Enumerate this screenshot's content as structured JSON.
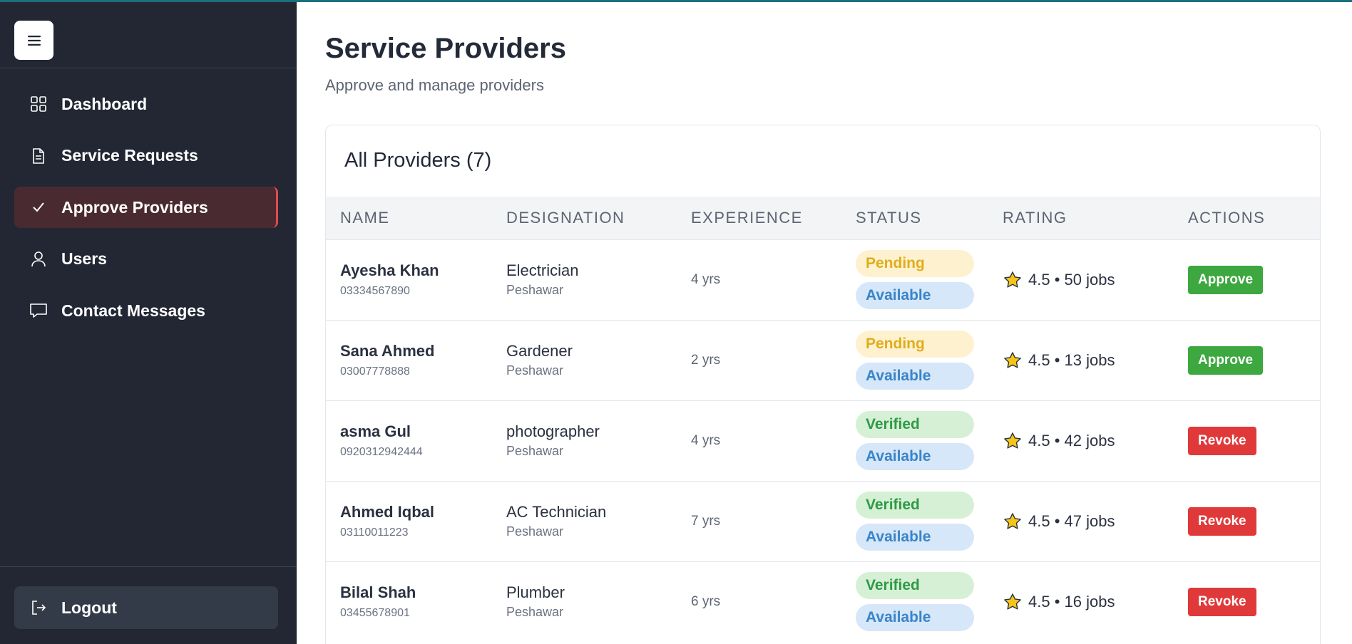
{
  "sidebar": {
    "items": [
      {
        "label": "Dashboard",
        "icon": "grid-icon"
      },
      {
        "label": "Service Requests",
        "icon": "document-icon"
      },
      {
        "label": "Approve Providers",
        "icon": "check-icon",
        "active": true
      },
      {
        "label": "Users",
        "icon": "user-icon"
      },
      {
        "label": "Contact Messages",
        "icon": "chat-icon"
      }
    ],
    "logout_label": "Logout"
  },
  "page": {
    "title": "Service Providers",
    "subtitle": "Approve and manage providers"
  },
  "card": {
    "title": "All Providers (7)"
  },
  "table": {
    "headers": [
      "NAME",
      "DESIGNATION",
      "EXPERIENCE",
      "STATUS",
      "RATING",
      "ACTIONS"
    ],
    "rows": [
      {
        "name": "Ayesha Khan",
        "phone": "03334567890",
        "designation": "Electrician",
        "city": "Peshawar",
        "experience": "4 yrs",
        "status": "Pending",
        "availability": "Available",
        "rating": "4.5 • 50 jobs",
        "action": "Approve"
      },
      {
        "name": "Sana Ahmed",
        "phone": "03007778888",
        "designation": "Gardener",
        "city": "Peshawar",
        "experience": "2 yrs",
        "status": "Pending",
        "availability": "Available",
        "rating": "4.5 • 13 jobs",
        "action": "Approve"
      },
      {
        "name": "asma Gul",
        "phone": "0920312942444",
        "designation": "photographer",
        "city": "Peshawar",
        "experience": "4 yrs",
        "status": "Verified",
        "availability": "Available",
        "rating": "4.5 • 42 jobs",
        "action": "Revoke"
      },
      {
        "name": "Ahmed Iqbal",
        "phone": "03110011223",
        "designation": "AC Technician",
        "city": "Peshawar",
        "experience": "7 yrs",
        "status": "Verified",
        "availability": "Available",
        "rating": "4.5 • 47 jobs",
        "action": "Revoke"
      },
      {
        "name": "Bilal Shah",
        "phone": "03455678901",
        "designation": "Plumber",
        "city": "Peshawar",
        "experience": "6 yrs",
        "status": "Verified",
        "availability": "Available",
        "rating": "4.5 • 16 jobs",
        "action": "Revoke"
      }
    ]
  },
  "colors": {
    "sidebar_bg": "#222733",
    "active_bg": "#4a2a31",
    "active_accent": "#e24b4b",
    "approve": "#3ca83f",
    "revoke": "#e0393a",
    "pending": "#e0ad1b",
    "verified": "#2f9a45",
    "available": "#3a84c9",
    "star": "#f5c518"
  }
}
